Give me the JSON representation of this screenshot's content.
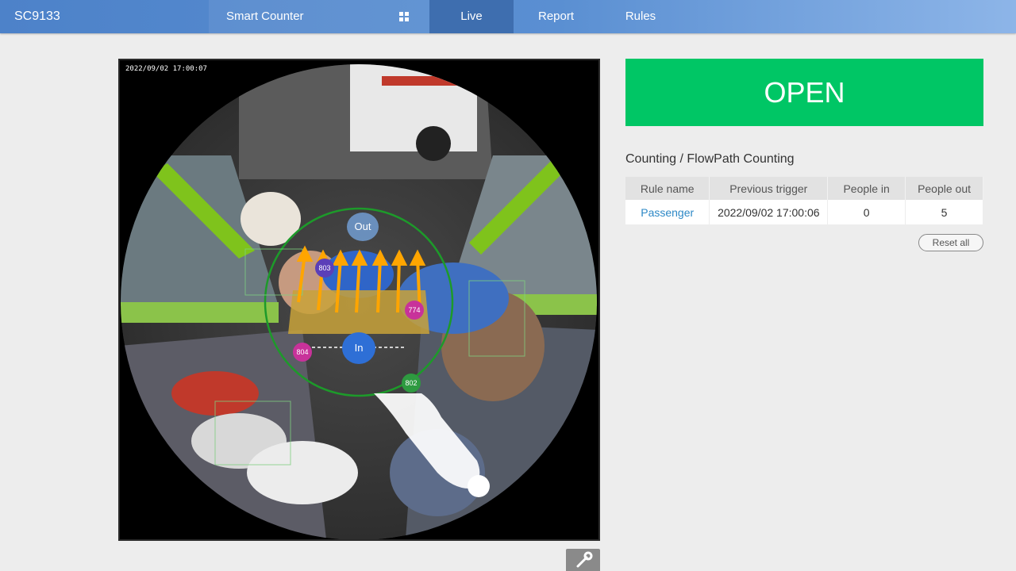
{
  "header": {
    "device_name": "SC9133",
    "app_name": "Smart Counter",
    "tabs": [
      {
        "label": "Live",
        "active": true
      },
      {
        "label": "Report",
        "active": false
      },
      {
        "label": "Rules",
        "active": false
      }
    ]
  },
  "video": {
    "timestamp": "2022/09/02 17:00:07",
    "zone_labels": {
      "out": "Out",
      "in": "In"
    },
    "track_ids": [
      "803",
      "774",
      "804",
      "802"
    ]
  },
  "status": {
    "label": "OPEN",
    "color": "#00c665"
  },
  "counting": {
    "title": "Counting / FlowPath Counting",
    "columns": [
      "Rule name",
      "Previous trigger",
      "People in",
      "People out"
    ],
    "rows": [
      {
        "rule_name": "Passenger",
        "previous_trigger": "2022/09/02 17:00:06",
        "people_in": "0",
        "people_out": "5"
      }
    ],
    "reset_label": "Reset all"
  },
  "icons": {
    "menu_grid": "grid-icon",
    "settings_tool": "wrench-icon"
  },
  "colors": {
    "nav_bar": "#4d82c9",
    "active_tab": "#3e6eaf",
    "link": "#2d88c6",
    "flow_arrow": "#ffa500"
  }
}
